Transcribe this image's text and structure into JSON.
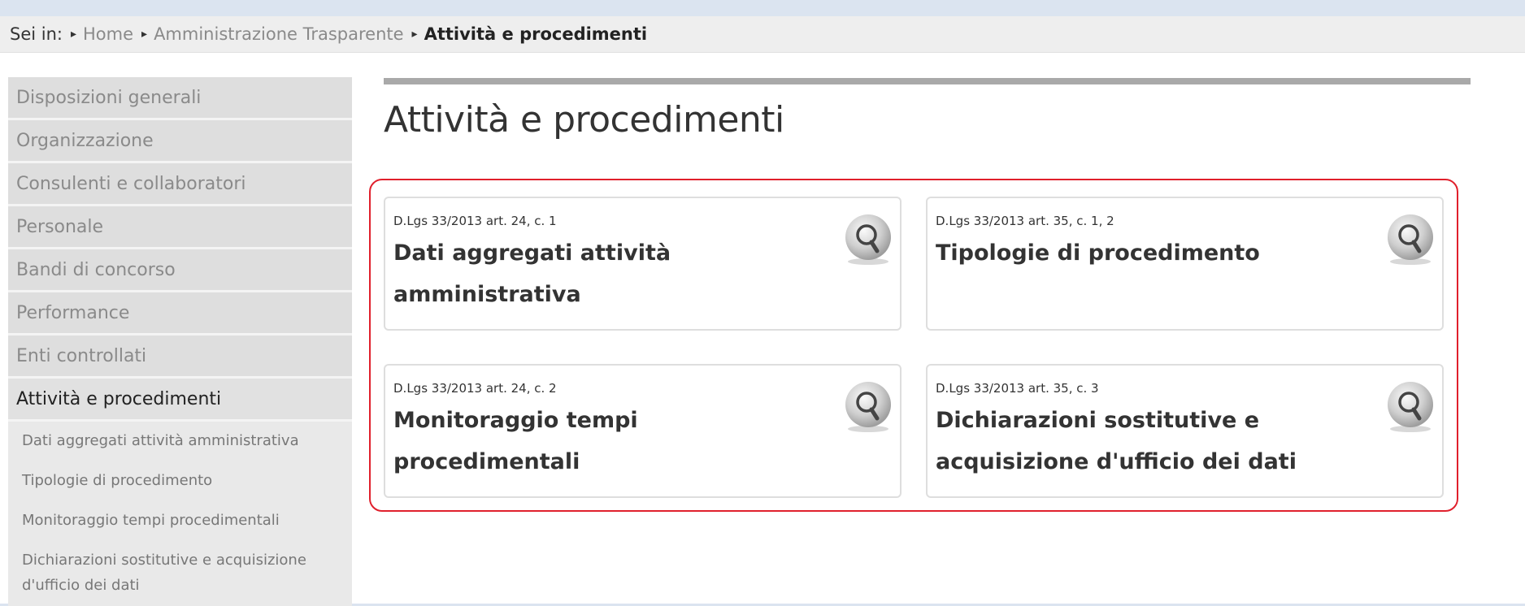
{
  "breadcrumb": {
    "lead": "Sei in:",
    "items": [
      "Home",
      "Amministrazione Trasparente"
    ],
    "current": "Attività e procedimenti"
  },
  "sidebar": {
    "items": [
      {
        "label": "Disposizioni generali"
      },
      {
        "label": "Organizzazione"
      },
      {
        "label": "Consulenti e collaboratori"
      },
      {
        "label": "Personale"
      },
      {
        "label": "Bandi di concorso"
      },
      {
        "label": "Performance"
      },
      {
        "label": "Enti controllati"
      },
      {
        "label": "Attività e procedimenti",
        "active": true
      }
    ],
    "subitems": [
      {
        "label": "Dati aggregati attività amministrativa"
      },
      {
        "label": "Tipologie di procedimento"
      },
      {
        "label": "Monitoraggio tempi procedimentali"
      },
      {
        "label": "Dichiarazioni sostitutive e acquisizione d'ufficio dei dati"
      }
    ]
  },
  "main": {
    "title": "Attività e procedimenti",
    "cards": [
      {
        "ref": "D.Lgs 33/2013 art. 24, c. 1",
        "title": "Dati aggregati attività amministrativa",
        "icon": "magnifier-icon"
      },
      {
        "ref": "D.Lgs 33/2013 art. 35, c. 1, 2",
        "title": "Tipologie di procedimento",
        "icon": "magnifier-icon"
      },
      {
        "ref": "D.Lgs 33/2013 art. 24, c. 2",
        "title": "Monitoraggio tempi procedimentali",
        "icon": "magnifier-icon"
      },
      {
        "ref": "D.Lgs 33/2013 art. 35, c. 3",
        "title": "Dichiarazioni sostitutive e acquisizione d'ufficio dei dati",
        "icon": "magnifier-icon"
      }
    ]
  },
  "colors": {
    "accent": "#e0202c",
    "sidebar_bg": "#dedede",
    "breadcrumb_bg": "#eeeeee"
  }
}
